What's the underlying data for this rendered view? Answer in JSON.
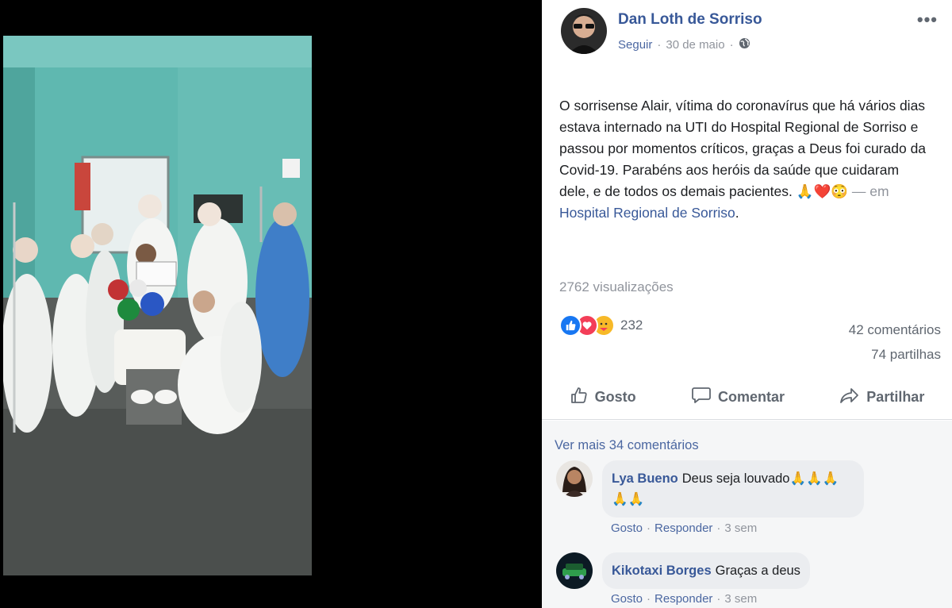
{
  "post": {
    "author": "Dan Loth de Sorriso",
    "follow": "Seguir",
    "date": "30 de maio",
    "globe_icon": "globe-icon",
    "more": "•••",
    "text": "O sorrisense Alair, vítima do coronavírus que há vários dias estava internado na UTI do Hospital Regional de Sorriso e passou por momentos críticos, graças a Deus foi curado da Covid-19. Parabéns aos heróis da saúde que cuidaram dele, e de todos os demais pacientes. 🙏❤️😳",
    "em": "— em",
    "place": "Hospital Regional de Sorriso",
    "place_suffix": ".",
    "views": "2762 visualizações",
    "reaction_count": "232",
    "comments_count": "42 comentários",
    "shares_count": "74 partilhas"
  },
  "actions": {
    "like": "Gosto",
    "comment": "Comentar",
    "share": "Partilhar"
  },
  "comments": {
    "see_more": "Ver mais 34 comentários",
    "items": [
      {
        "name": "Lya Bueno",
        "text": "Deus seja louvado🙏🙏🙏🙏🙏",
        "like": "Gosto",
        "reply": "Responder",
        "time": "3 sem"
      },
      {
        "name": "Kikotaxi Borges",
        "text": "Graças a deus",
        "like": "Gosto",
        "reply": "Responder",
        "time": "3 sem"
      }
    ]
  },
  "colors": {
    "link": "#385898",
    "muted": "#90949c",
    "like_blue": "#1877f2",
    "love_red": "#f33e58"
  }
}
